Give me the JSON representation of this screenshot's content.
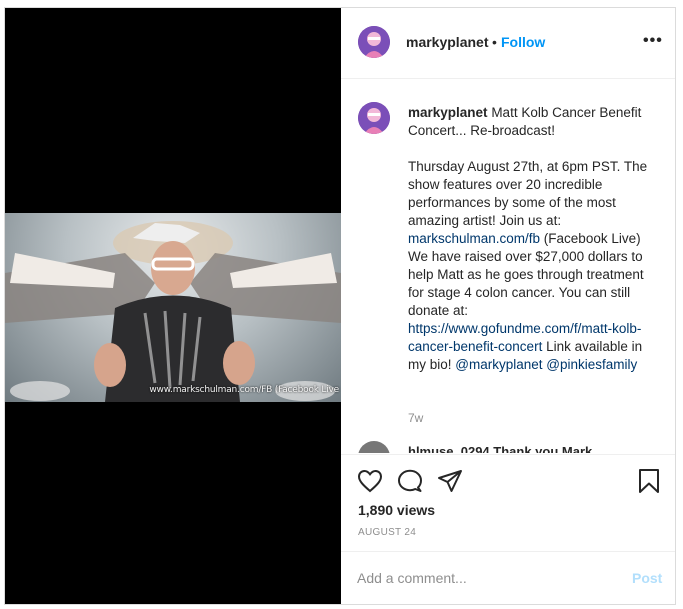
{
  "post": {
    "username": "markyplanet",
    "dot": "•",
    "follow_label": "Follow",
    "more_label": "•••",
    "video_caption": "www.markschulman.com/FB (Facebook Live"
  },
  "caption": {
    "username": "markyplanet",
    "title": "Matt Kolb Cancer Benefit Concert... Re-broadcast!",
    "body_1": "Thursday August 27th, at 6pm PST. The show features over 20 incredible performances by some of the most amazing artist! Join us at: ",
    "link_1": "markschulman.com/fb",
    "body_2": " (Facebook Live) We have raised over $27,000 dollars to help Matt as he goes through treatment for stage 4 colon cancer. You can still donate at: ",
    "link_2": "https://www.gofundme.com/f/matt-kolb-cancer-benefit-concert",
    "body_3": " Link available in my bio! ",
    "mention_1": "@markyplanet",
    "mention_2": "@pinkiesfamily",
    "age": "7w"
  },
  "next_comment": {
    "text": "hlmuse_0294 Thank you Mark"
  },
  "actions": {
    "like_icon": "heart-icon",
    "comment_icon": "comment-icon",
    "share_icon": "paper-plane-icon",
    "save_icon": "bookmark-icon",
    "views": "1,890 views",
    "date": "AUGUST 24"
  },
  "comment_box": {
    "placeholder": "Add a comment...",
    "post_label": "Post"
  },
  "colors": {
    "link": "#00376b",
    "follow": "#0095f6",
    "muted": "#8e8e8e",
    "post_disabled": "#b2dffc"
  }
}
